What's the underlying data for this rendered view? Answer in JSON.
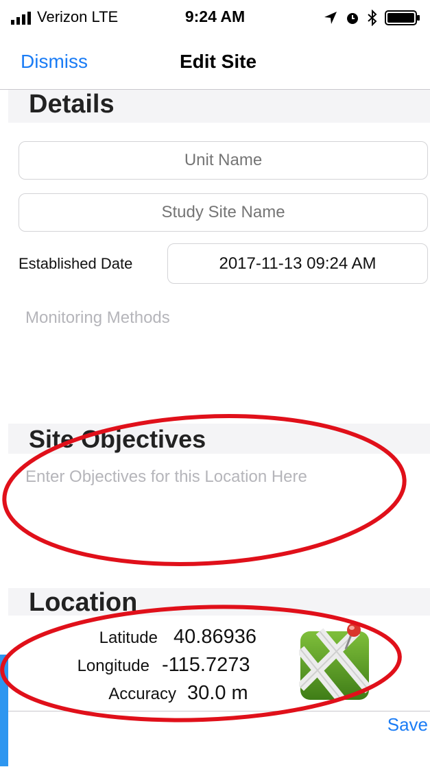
{
  "status_bar": {
    "carrier": "Verizon  LTE",
    "time": "9:24 AM"
  },
  "nav": {
    "dismiss_label": "Dismiss",
    "title": "Edit Site"
  },
  "details": {
    "heading": "Details",
    "unit_name_placeholder": "Unit Name",
    "study_site_placeholder": "Study Site Name",
    "established_label": "Established Date",
    "established_value": "2017-11-13 09:24 AM",
    "monitoring_methods_placeholder": "Monitoring Methods"
  },
  "objectives": {
    "heading": "Site Objectives",
    "placeholder": "Enter Objectives for this Location Here"
  },
  "location": {
    "heading": "Location",
    "latitude_label": "Latitude",
    "latitude_value": "40.86936",
    "longitude_label": "Longitude",
    "longitude_value": "-115.7273",
    "accuracy_label": "Accuracy",
    "accuracy_value": "30.0 m",
    "map_icon": "map-pin-icon"
  },
  "toolbar": {
    "save_label": "Save"
  },
  "colors": {
    "accent": "#1a7cf5",
    "annotation": "#e0101a",
    "map_green": "#5c9a2a",
    "pin": "#d9362b"
  }
}
